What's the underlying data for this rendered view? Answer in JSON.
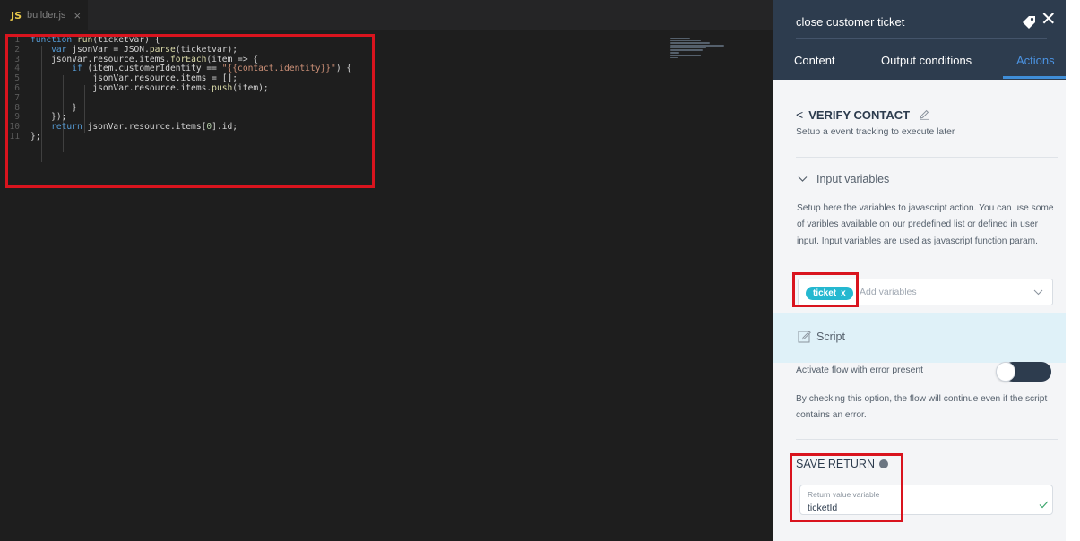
{
  "editor": {
    "tab": {
      "lang_badge": "JS",
      "filename": "builder.js",
      "close_glyph": "×"
    },
    "lines": [
      {
        "n": "1"
      },
      {
        "n": "2"
      },
      {
        "n": "3"
      },
      {
        "n": "4"
      },
      {
        "n": "5"
      },
      {
        "n": "6"
      },
      {
        "n": "7"
      },
      {
        "n": "8"
      },
      {
        "n": "9"
      },
      {
        "n": "10"
      },
      {
        "n": "11"
      }
    ],
    "code": {
      "l1_kw": "function",
      "l1_fn": "run",
      "l1_rest": "(ticketvar) {",
      "l2_kw": "var",
      "l2_a": " jsonVar = JSON.",
      "l2_fn": "parse",
      "l2_b": "(ticketvar);",
      "l3_a": "jsonVar.resource.items.",
      "l3_fn": "forEach",
      "l3_b": "(item => {",
      "l4_kw": "if",
      "l4_a": " (item.customerIdentity == ",
      "l4_str": "\"{{contact.identity}}\"",
      "l4_b": ") {",
      "l5": "jsonVar.resource.items = [];",
      "l6_a": "jsonVar.resource.items.",
      "l6_fn": "push",
      "l6_b": "(item);",
      "l8": "}",
      "l9": "});",
      "l10_kw": "return",
      "l10_a": " jsonVar.resource.items[",
      "l10_num": "0",
      "l10_b": "].id;",
      "l11": "};"
    }
  },
  "panel": {
    "title": "close customer ticket",
    "close_glyph": "✕",
    "tabs": {
      "content": "Content",
      "output": "Output conditions",
      "actions": "Actions"
    },
    "action": {
      "back_glyph": "<",
      "name": "VERIFY CONTACT",
      "subtitle": "Setup a event tracking to execute later"
    },
    "input_variables": {
      "heading": "Input variables",
      "description": "Setup here the variables to javascript action. You can use some of varibles available on our predefined list or defined in user input. Input variables are used as javascript function param.",
      "chip_label": "ticket",
      "chip_remove": "x",
      "placeholder": "Add variables"
    },
    "script": {
      "label": "Script"
    },
    "error_option": {
      "label": "Activate flow with error present",
      "enabled": false,
      "description": "By checking this option, the flow will continue even if the script contains an error."
    },
    "save_return": {
      "heading": "SAVE RETURN",
      "field_label": "Return value variable",
      "field_value": "ticketId"
    }
  },
  "colors": {
    "accent": "#3f8ed8",
    "header_bg": "#2d3c4e",
    "chip_bg": "#25b8d0",
    "highlight_red": "#d9141e"
  }
}
